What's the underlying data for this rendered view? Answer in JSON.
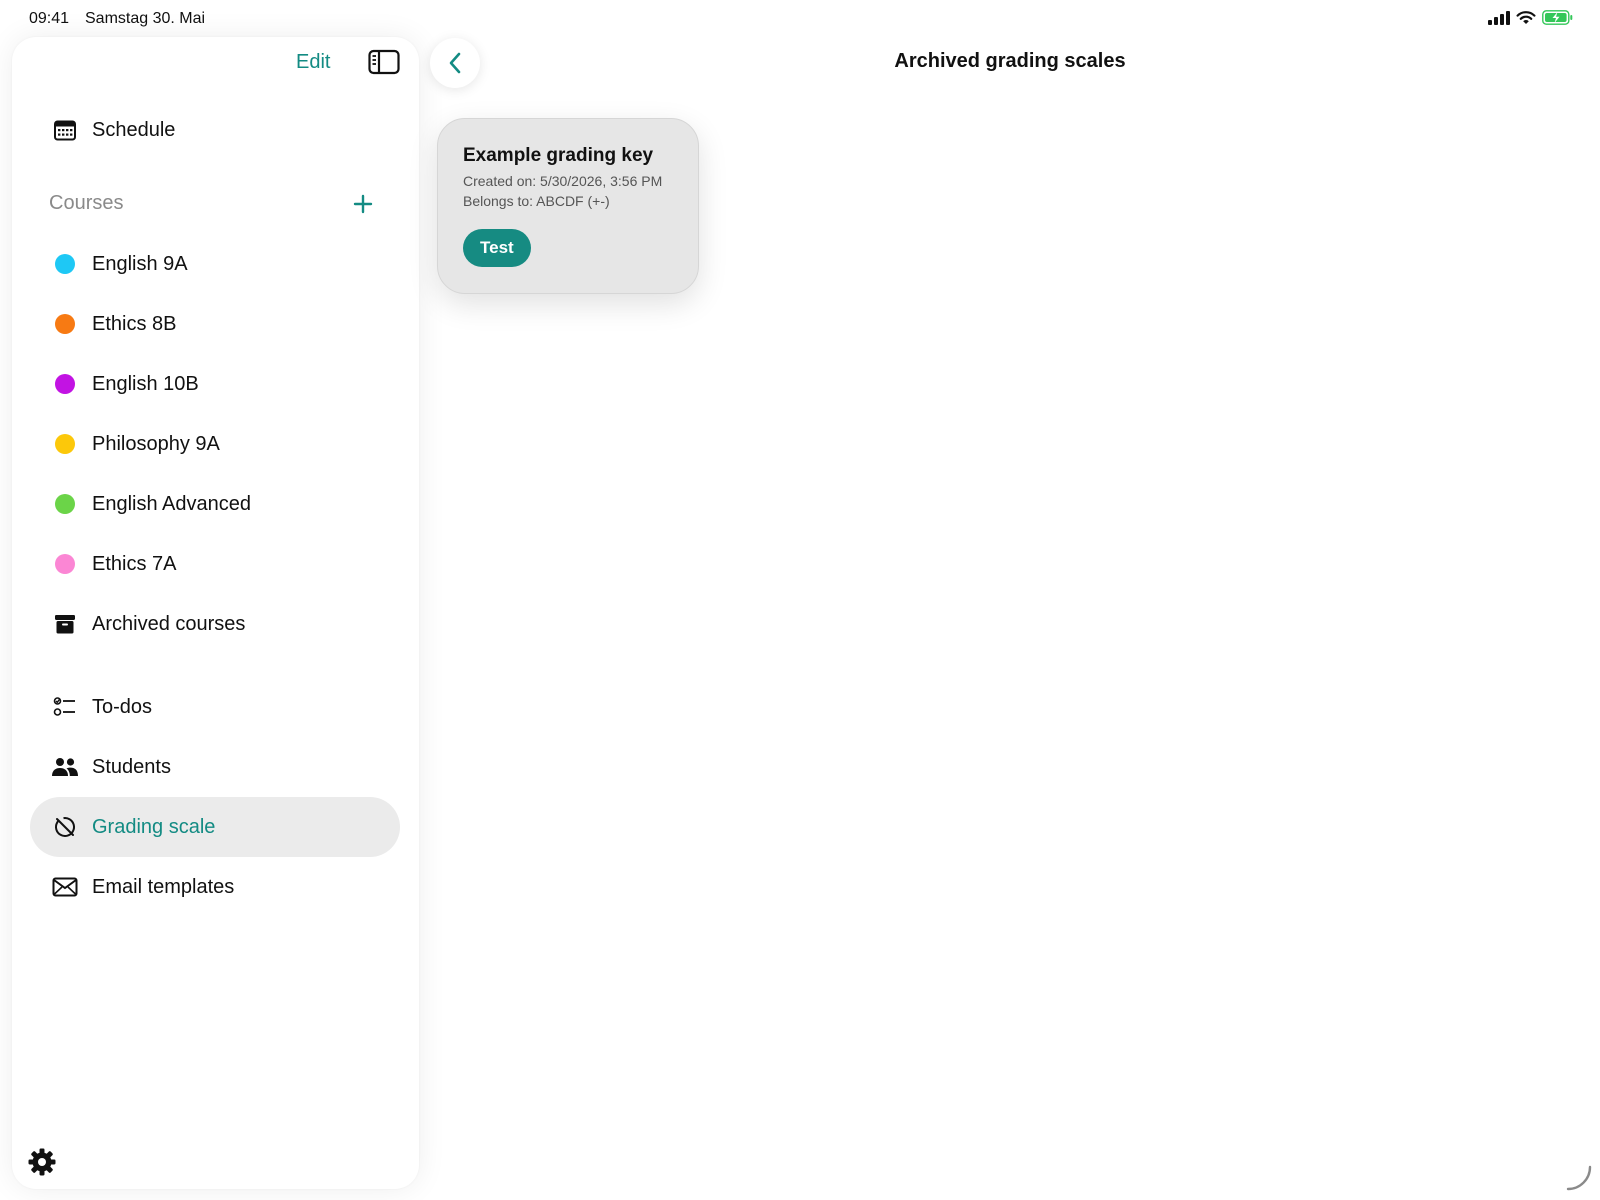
{
  "status_bar": {
    "time": "09:41",
    "date": "Samstag 30. Mai"
  },
  "sidebar": {
    "edit_label": "Edit",
    "schedule_label": "Schedule",
    "courses_title": "Courses",
    "courses": [
      {
        "label": "English 9A",
        "color": "#1ec8f5"
      },
      {
        "label": "Ethics 8B",
        "color": "#f77a13"
      },
      {
        "label": "English 10B",
        "color": "#c213e3"
      },
      {
        "label": "Philosophy 9A",
        "color": "#fcc80a"
      },
      {
        "label": "English Advanced",
        "color": "#6bd448"
      },
      {
        "label": "Ethics 7A",
        "color": "#fb86d4"
      }
    ],
    "archived_courses_label": "Archived courses",
    "tools": [
      {
        "label": "To-dos",
        "icon": "checklist-icon"
      },
      {
        "label": "Students",
        "icon": "people-icon"
      },
      {
        "label": "Grading scale",
        "icon": "grading-scale-icon",
        "active": true
      },
      {
        "label": "Email templates",
        "icon": "envelope-icon"
      }
    ]
  },
  "main": {
    "title": "Archived grading scales",
    "cards": [
      {
        "title": "Example grading key",
        "created": "Created on: 5/30/2026, 3:56 PM",
        "belongs": "Belongs to: ABCDF (+-)",
        "tag": "Test"
      }
    ]
  },
  "colors": {
    "accent": "#138b83",
    "active_bg": "#ebebeb",
    "card_bg": "#e6e6e6"
  }
}
